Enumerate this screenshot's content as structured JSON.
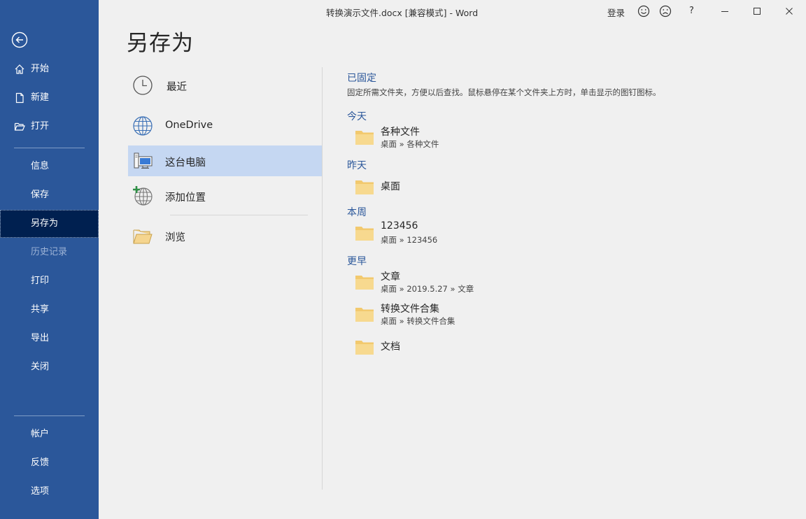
{
  "window": {
    "title": "转换演示文件.docx [兼容模式]  -  Word",
    "signin": "登录",
    "help": "?"
  },
  "sidebar": {
    "items": [
      {
        "label": "开始"
      },
      {
        "label": "新建"
      },
      {
        "label": "打开"
      },
      {
        "label": "信息"
      },
      {
        "label": "保存"
      },
      {
        "label": "另存为"
      },
      {
        "label": "历史记录"
      },
      {
        "label": "打印"
      },
      {
        "label": "共享"
      },
      {
        "label": "导出"
      },
      {
        "label": "关闭"
      },
      {
        "label": "帐户"
      },
      {
        "label": "反馈"
      },
      {
        "label": "选项"
      }
    ]
  },
  "page": {
    "title": "另存为"
  },
  "locations": [
    {
      "label": "最近"
    },
    {
      "label": "OneDrive"
    },
    {
      "label": "这台电脑"
    },
    {
      "label": "添加位置"
    },
    {
      "label": "浏览"
    }
  ],
  "pinned": {
    "heading": "已固定",
    "desc": "固定所需文件夹，方便以后查找。鼠标悬停在某个文件夹上方时，单击显示的图钉图标。"
  },
  "groups": [
    {
      "heading": "今天",
      "folders": [
        {
          "name": "各种文件",
          "path": "桌面 » 各种文件"
        }
      ]
    },
    {
      "heading": "昨天",
      "folders": [
        {
          "name": "桌面",
          "path": ""
        }
      ]
    },
    {
      "heading": "本周",
      "folders": [
        {
          "name": "123456",
          "path": "桌面 » 123456"
        }
      ]
    },
    {
      "heading": "更早",
      "folders": [
        {
          "name": "文章",
          "path": "桌面 » 2019.5.27 » 文章"
        },
        {
          "name": "转换文件合集",
          "path": "桌面 » 转换文件合集"
        },
        {
          "name": "文档",
          "path": ""
        }
      ]
    }
  ]
}
